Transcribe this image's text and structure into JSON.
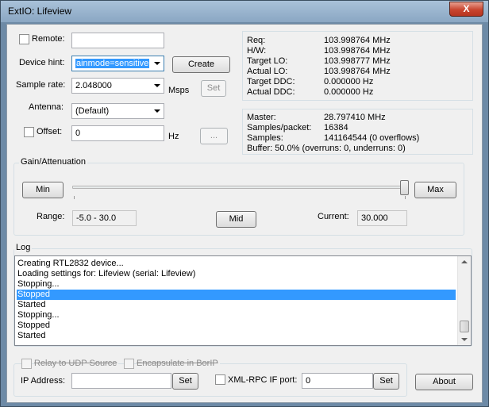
{
  "window": {
    "title": "ExtIO: Lifeview",
    "close_glyph": "X"
  },
  "remote": {
    "label": "Remote:",
    "checked": false,
    "value": ""
  },
  "device_hint": {
    "label": "Device hint:",
    "value": "ainmode=sensitive",
    "create_label": "Create"
  },
  "sample_rate": {
    "label": "Sample rate:",
    "value": "2.048000",
    "unit": "Msps",
    "set_label": "Set"
  },
  "antenna": {
    "label": "Antenna:",
    "value": "(Default)"
  },
  "offset": {
    "label": "Offset:",
    "checked": false,
    "value": "0",
    "unit": "Hz",
    "browse_label": "..."
  },
  "freq_info": {
    "rows": [
      {
        "key": "Req:",
        "value": "103.998764 MHz"
      },
      {
        "key": "H/W:",
        "value": "103.998764 MHz"
      },
      {
        "key": "Target LO:",
        "value": "103.998777 MHz"
      },
      {
        "key": "Actual LO:",
        "value": "103.998764 MHz"
      },
      {
        "key": "Target DDC:",
        "value": "0.000000 Hz"
      },
      {
        "key": "Actual DDC:",
        "value": "0.000000 Hz"
      }
    ]
  },
  "stream_info": {
    "rows": [
      {
        "key": "Master:",
        "value": "28.797410 MHz"
      },
      {
        "key": "Samples/packet:",
        "value": "16384"
      },
      {
        "key": "Samples:",
        "value": "141164544 (0 overflows)"
      }
    ],
    "buffer": "Buffer: 50.0% (overruns: 0, underruns: 0)"
  },
  "gain": {
    "group_label": "Gain/Attenuation",
    "min_label": "Min",
    "max_label": "Max",
    "mid_label": "Mid",
    "range_label": "Range:",
    "range_value": "-5.0 - 30.0",
    "current_label": "Current:",
    "current_value": "30.000",
    "level_fraction": 1.0
  },
  "log": {
    "label": "Log",
    "lines": [
      "Creating RTL2832 device...",
      "Loading settings for: Lifeview (serial: Lifeview)",
      "Stopping...",
      "Stopped",
      "Started",
      "Stopping...",
      "Stopped",
      "Started"
    ],
    "selected_index": 3
  },
  "bottom": {
    "relay_label": "Relay to UDP Source",
    "encapsulate_label": "Encapsulate in BorIP",
    "ip_label": "IP Address:",
    "ip_value": "",
    "ip_set_label": "Set",
    "xmlrpc_label": "XML-RPC IF port:",
    "xmlrpc_value": "0",
    "xmlrpc_set_label": "Set",
    "about_label": "About"
  },
  "colors": {
    "selection": "#3399ff",
    "titlebar": "#9bb5cf",
    "close": "#c8452f"
  }
}
